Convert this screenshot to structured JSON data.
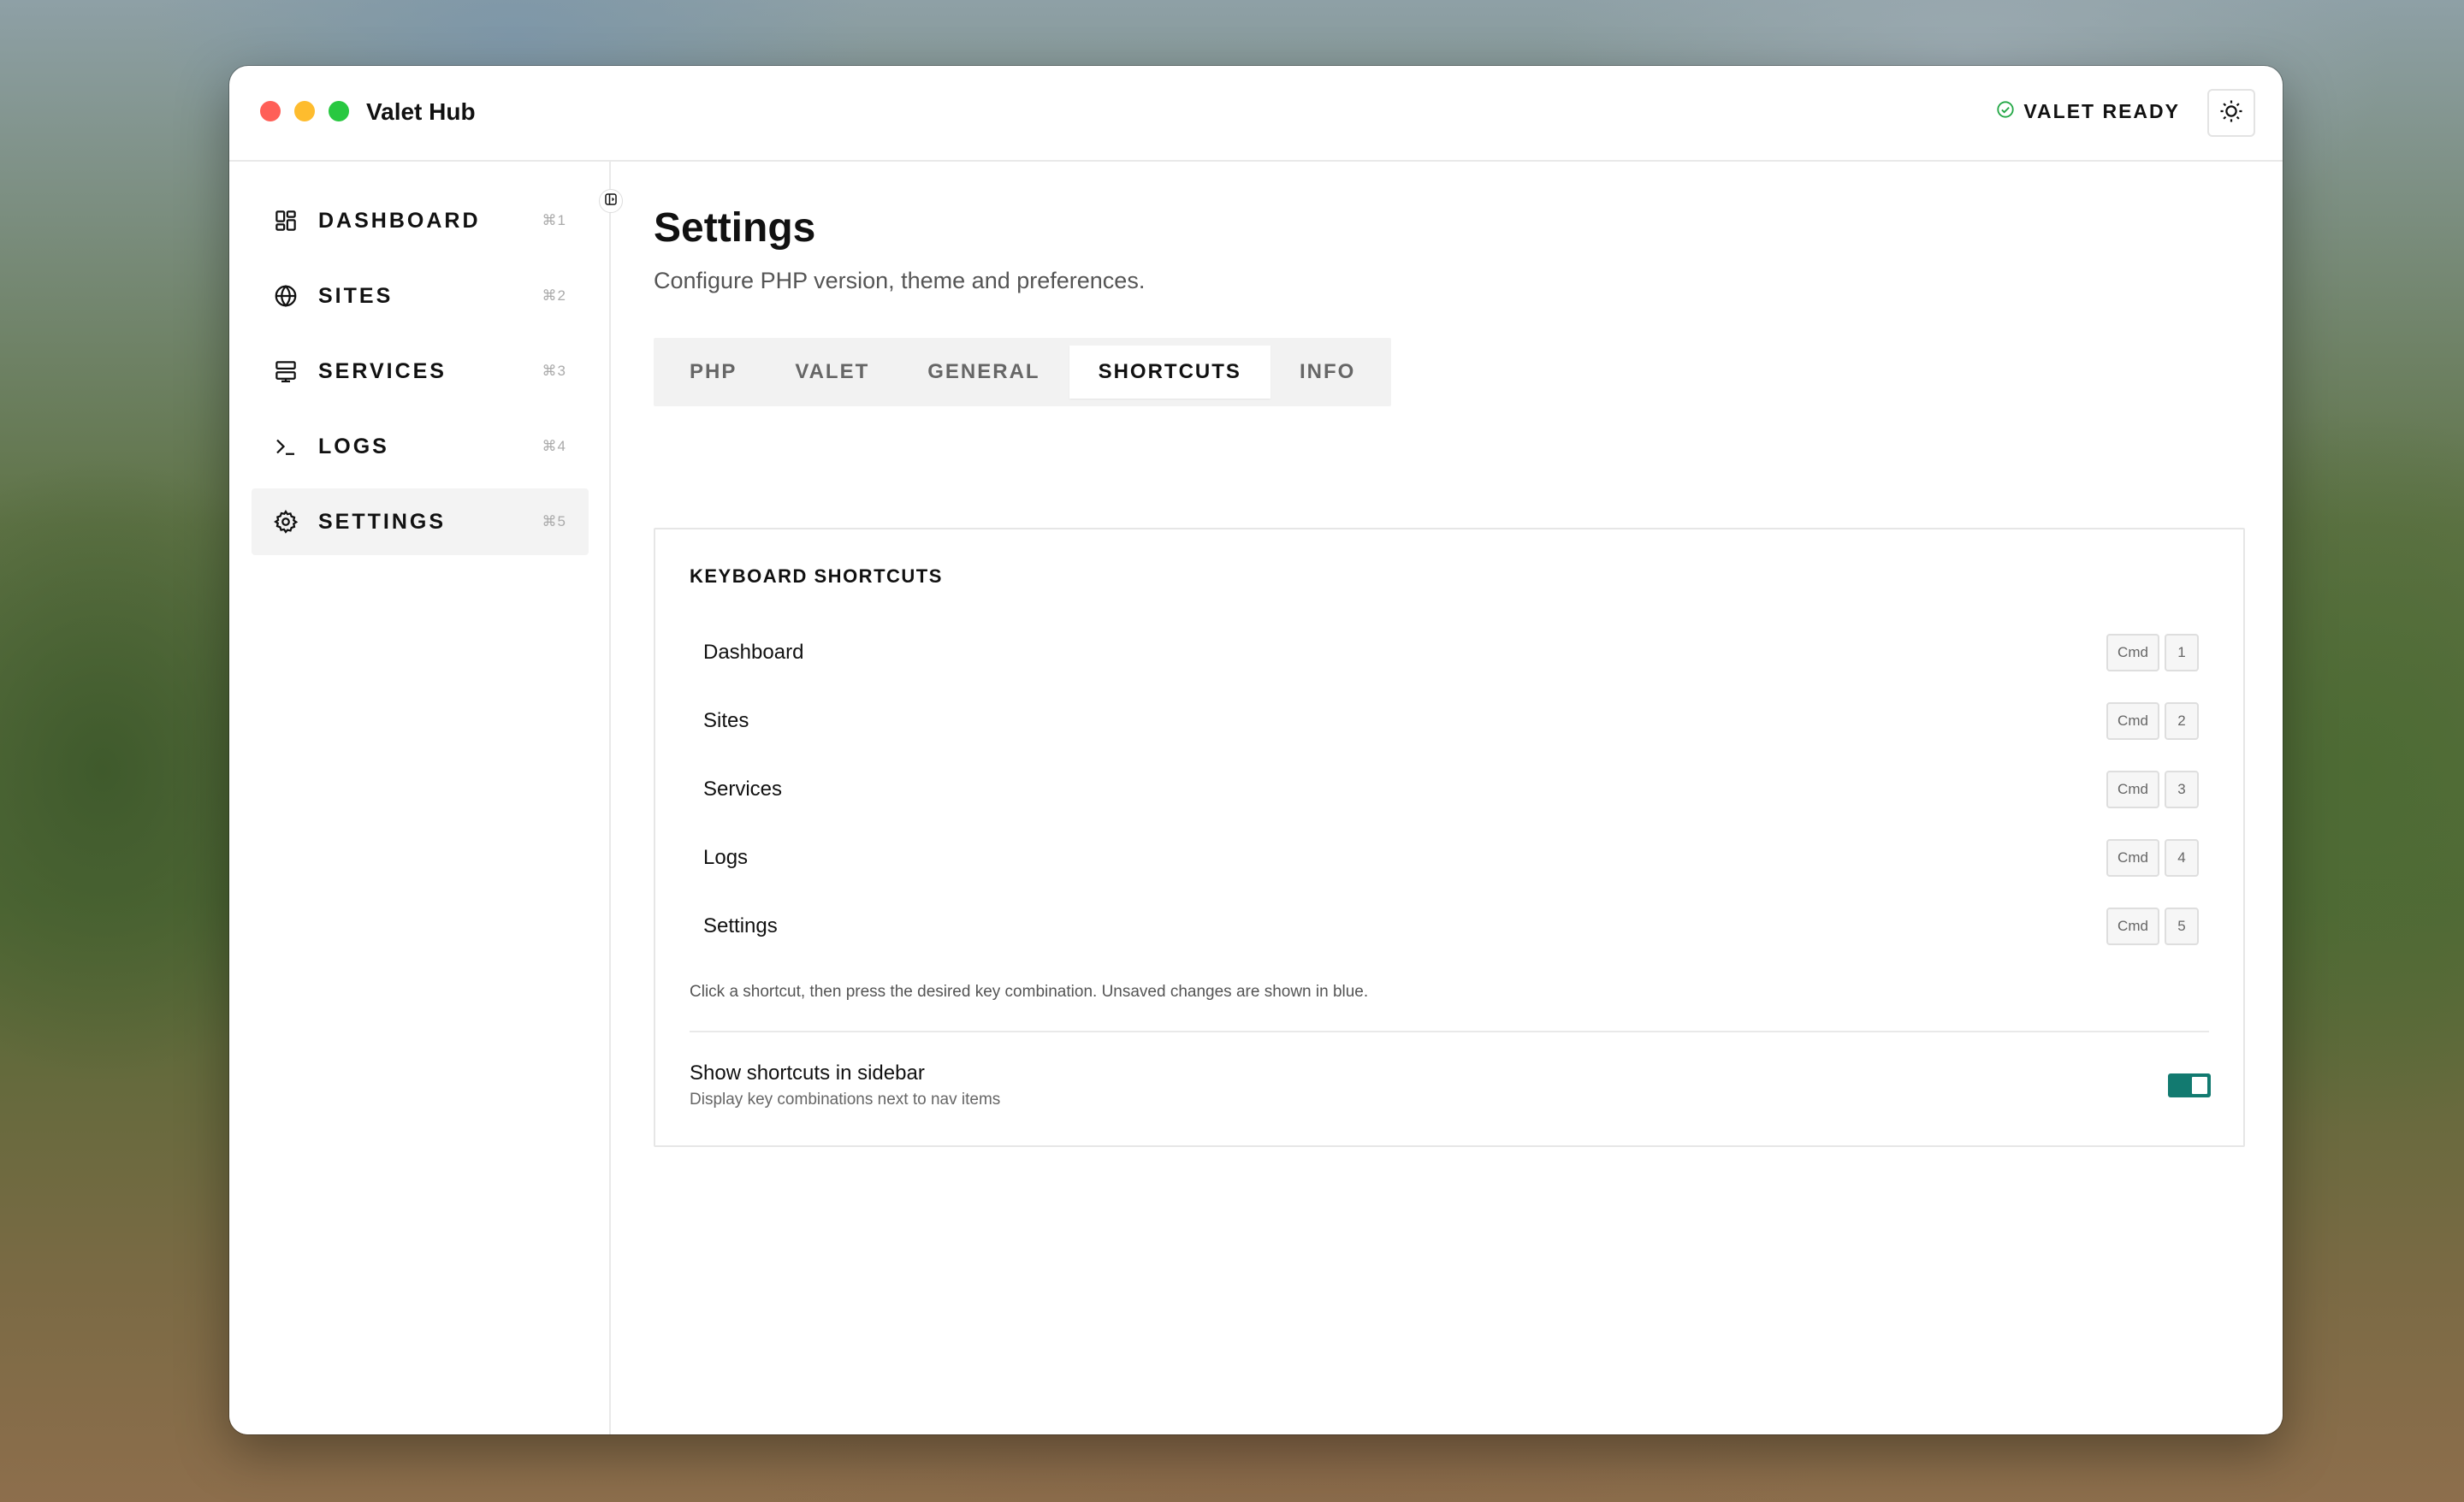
{
  "app": {
    "title": "Valet Hub"
  },
  "header": {
    "status_label": "VALET READY",
    "status_icon": "check-circle-icon",
    "status_color": "#22a745",
    "theme_icon": "sun-icon"
  },
  "sidebar": {
    "items": [
      {
        "label": "DASHBOARD",
        "shortcut": "⌘1",
        "icon": "dashboard-icon"
      },
      {
        "label": "SITES",
        "shortcut": "⌘2",
        "icon": "globe-icon"
      },
      {
        "label": "SERVICES",
        "shortcut": "⌘3",
        "icon": "server-icon"
      },
      {
        "label": "LOGS",
        "shortcut": "⌘4",
        "icon": "terminal-icon"
      },
      {
        "label": "SETTINGS",
        "shortcut": "⌘5",
        "icon": "gear-icon",
        "active": true
      }
    ]
  },
  "main": {
    "title": "Settings",
    "subtitle": "Configure PHP version, theme and preferences.",
    "tabs": [
      {
        "label": "PHP"
      },
      {
        "label": "VALET"
      },
      {
        "label": "GENERAL"
      },
      {
        "label": "SHORTCUTS",
        "active": true
      },
      {
        "label": "INFO"
      }
    ],
    "shortcuts": {
      "title": "KEYBOARD SHORTCUTS",
      "rows": [
        {
          "name": "Dashboard",
          "mod": "Cmd",
          "key": "1"
        },
        {
          "name": "Sites",
          "mod": "Cmd",
          "key": "2"
        },
        {
          "name": "Services",
          "mod": "Cmd",
          "key": "3"
        },
        {
          "name": "Logs",
          "mod": "Cmd",
          "key": "4"
        },
        {
          "name": "Settings",
          "mod": "Cmd",
          "key": "5"
        }
      ],
      "hint": "Click a shortcut, then press the desired key combination. Unsaved changes are shown in blue.",
      "pref_title": "Show shortcuts in sidebar",
      "pref_desc": "Display key combinations next to nav items",
      "pref_enabled": true,
      "toggle_color": "#127a70"
    }
  }
}
